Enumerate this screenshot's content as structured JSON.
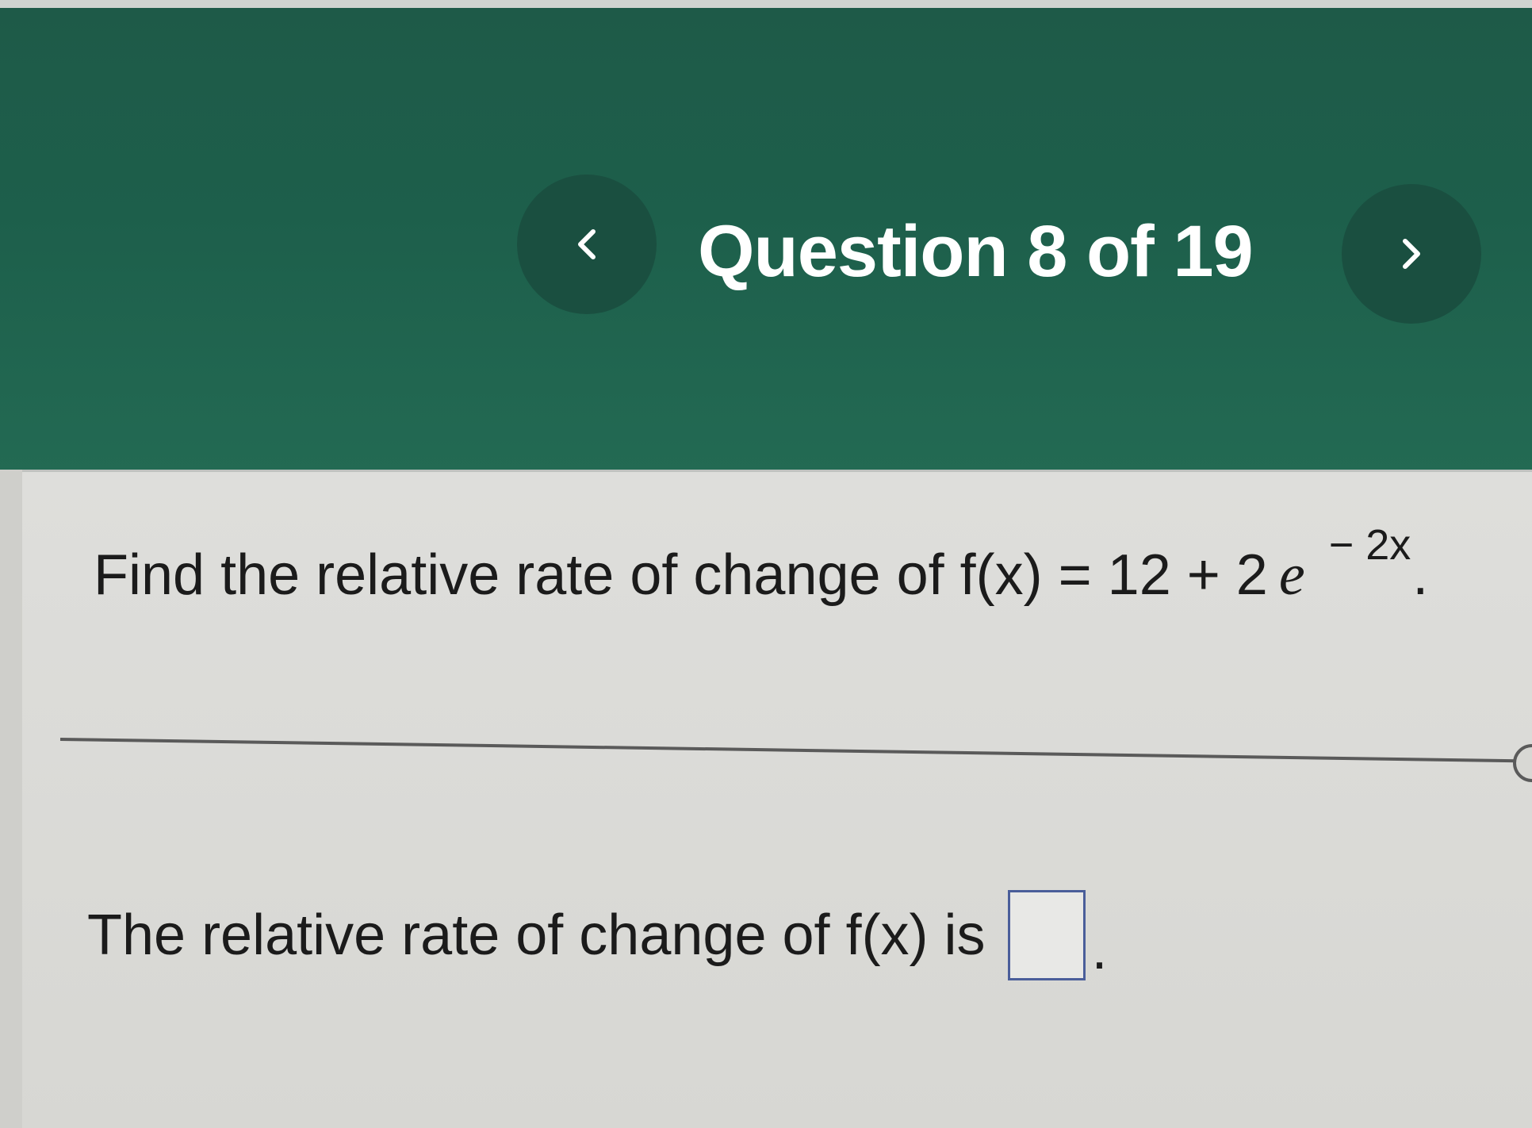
{
  "header": {
    "question_counter": "Question 8 of 19",
    "prev_icon": "chevron-left-icon",
    "next_icon": "chevron-right-icon",
    "background_color": "#1d5f4b"
  },
  "question": {
    "prompt_text": "Find the relative rate of change of f(x) = 12 + 2",
    "e_symbol": "e",
    "exponent": "− 2x",
    "period": "."
  },
  "answer": {
    "label": "The relative rate of change of f(x) is",
    "value": "",
    "period": "."
  }
}
